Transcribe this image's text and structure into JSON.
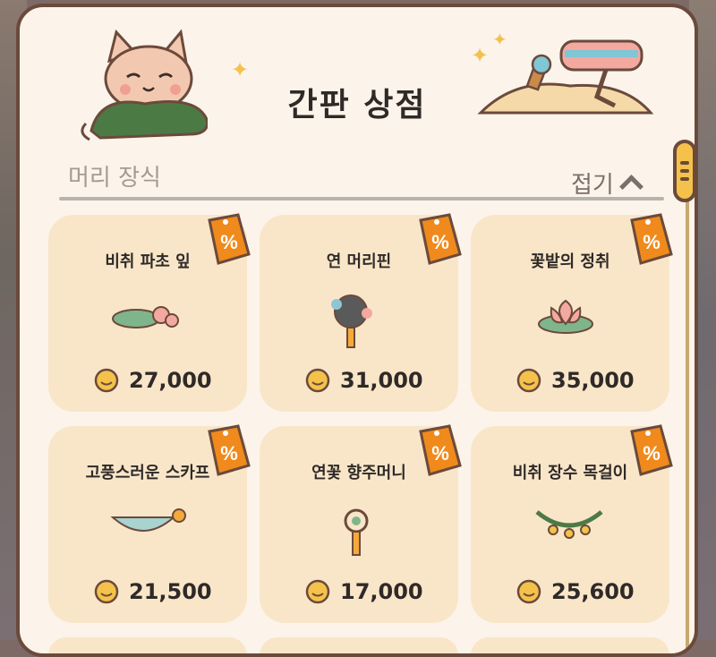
{
  "shop": {
    "title": "간판 상점"
  },
  "section": {
    "title": "머리 장식",
    "collapse_label": "접기"
  },
  "items": [
    {
      "name": "비취 파초 잎",
      "price": "27,000",
      "tag": "%"
    },
    {
      "name": "연 머리핀",
      "price": "31,000",
      "tag": "%"
    },
    {
      "name": "꽃밭의 정취",
      "price": "35,000",
      "tag": "%"
    },
    {
      "name": "고풍스러운 스카프",
      "price": "21,500",
      "tag": "%"
    },
    {
      "name": "연꽃 향주머니",
      "price": "17,000",
      "tag": "%"
    },
    {
      "name": "비취 장수 목걸이",
      "price": "25,600",
      "tag": "%"
    }
  ],
  "colors": {
    "panel": "#fcf4ea",
    "card": "#f9e6c9",
    "tag": "#f08a1c",
    "accent": "#f4c24a"
  }
}
